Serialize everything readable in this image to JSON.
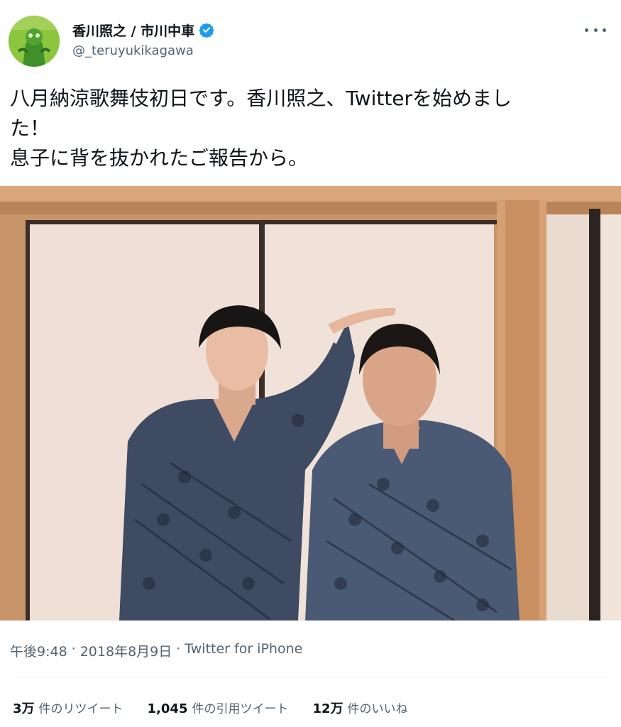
{
  "author": {
    "display_name": "香川照之 / 市川中車",
    "handle": "@_teruyukikagawa",
    "verified": true,
    "verified_icon": "verified-badge-icon",
    "avatar_icon": "avatar-green-costume"
  },
  "menu": {
    "more_icon": "more-options-icon"
  },
  "tweet": {
    "line1": "八月納涼歌舞伎初日です。香川照之、Twitterを始めまし",
    "line2": "た！",
    "line3": "息子に背を抜かれたご報告から。"
  },
  "meta": {
    "time": "午後9:48",
    "sep1": "·",
    "date": "2018年8月9日",
    "sep2": "·",
    "source": "Twitter for iPhone"
  },
  "stats": {
    "retweets": {
      "value": "3万",
      "label": "件のリツイート"
    },
    "quotes": {
      "value": "1,045",
      "label": "件の引用ツイート"
    },
    "likes": {
      "value": "12万",
      "label": "件のいいね"
    }
  },
  "colors": {
    "text": "#0f1419",
    "secondary": "#536471",
    "verified": "#1d9bf0",
    "divider": "#eff3f4"
  }
}
